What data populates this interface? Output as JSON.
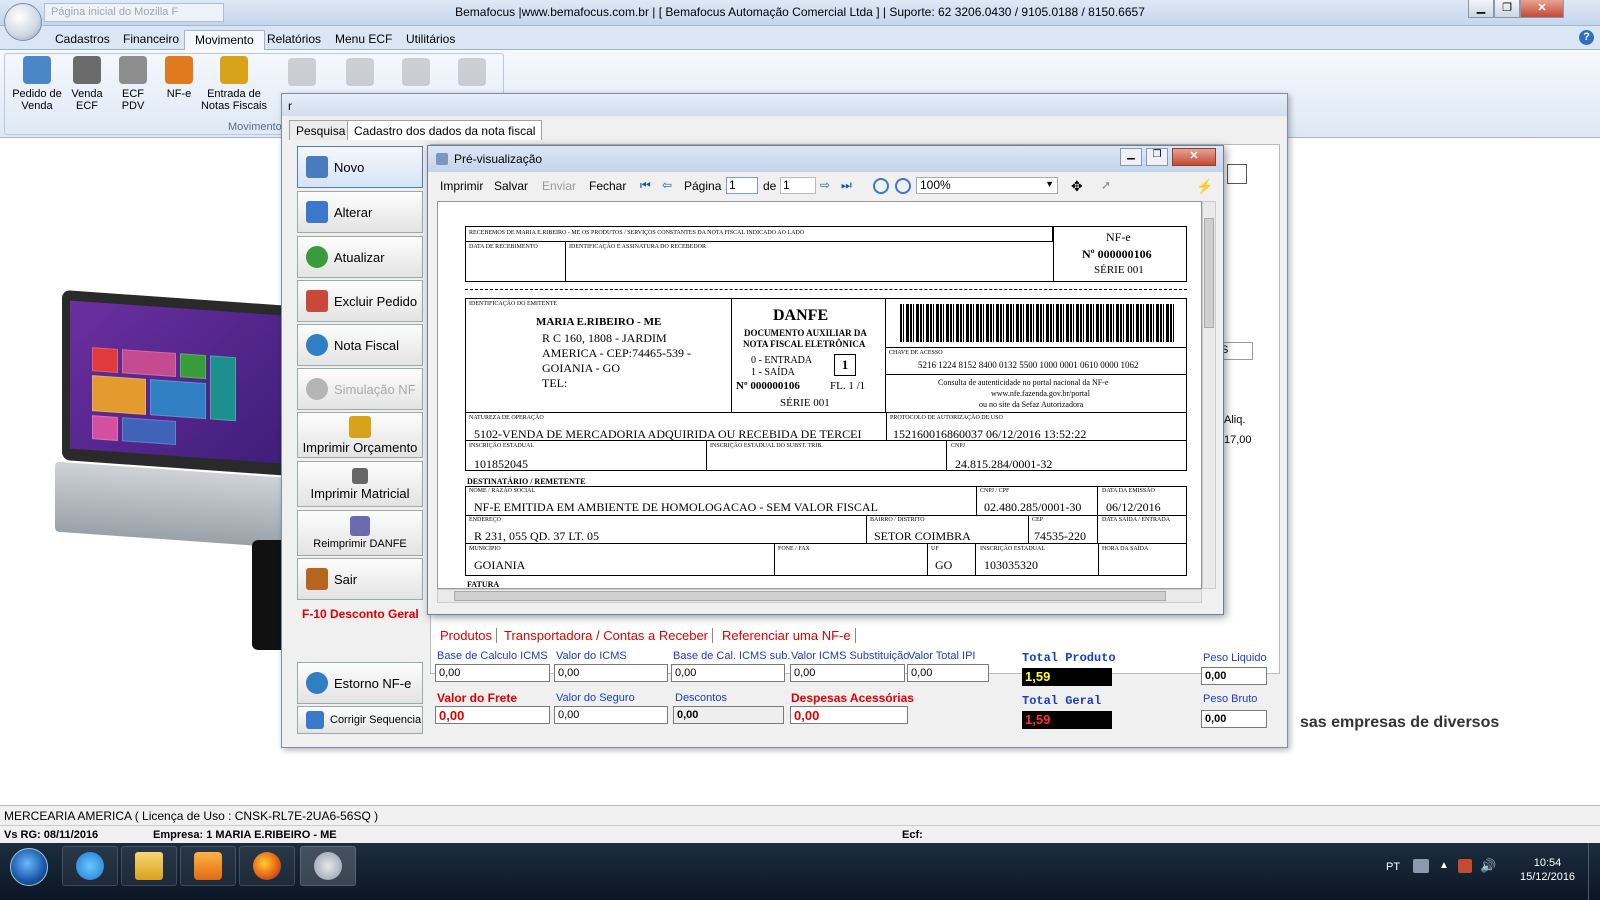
{
  "window": {
    "address_placeholder": "Página inicial do Mozilla F",
    "title": "Bemafocus |www.bemafocus.com.br | [ Bemafocus Automação Comercial Ltda ] | Suporte: 62 3206.0430 / 9105.0188 / 8150.6657",
    "min_label": "▁",
    "max_label": "❐",
    "close_label": "✕"
  },
  "menu": {
    "tabs": [
      "Cadastros",
      "Financeiro",
      "Movimento",
      "Relatórios",
      "Menu ECF",
      "Utilitários"
    ],
    "active": "Movimento",
    "help": "?"
  },
  "ribbon": {
    "buttons": [
      {
        "label": "Pedido de Venda",
        "icon": "basket-icon",
        "color": "#4a86c8"
      },
      {
        "label": "Venda ECF",
        "icon": "printer-icon",
        "color": "#6b6b6b"
      },
      {
        "label": "ECF PDV",
        "icon": "cart-icon",
        "color": "#8d8d8d"
      },
      {
        "label": "NF-e",
        "icon": "nfe-icon",
        "color": "#e07a1f"
      },
      {
        "label": "Entrada de Notas Fiscais",
        "icon": "forklift-icon",
        "color": "#d9a21b"
      }
    ],
    "group_label": "Movimento"
  },
  "main_dialog": {
    "title": "r",
    "tabs": [
      "Pesquisa",
      "Cadastro dos dados da nota fiscal"
    ],
    "active_tab": "Cadastro dos dados da nota fiscal",
    "buttons": [
      {
        "label": "Novo",
        "icon": "person-icon",
        "color": "#4b7bbf"
      },
      {
        "label": "Alterar",
        "icon": "edit-icon",
        "color": "#3a78c9"
      },
      {
        "label": "Atualizar",
        "icon": "refresh-icon",
        "color": "#3a9b3a"
      },
      {
        "label": "Excluir Pedido",
        "icon": "delete-icon",
        "color": "#c9483a"
      },
      {
        "label": "Nota Fiscal",
        "icon": "nfe-icon",
        "color": "#2f7fc2"
      },
      {
        "label": "Simulação  NF",
        "icon": "gear-icon",
        "color": "#b5b5b5"
      },
      {
        "label": "Imprimir Orçamento",
        "icon": "stack-icon",
        "color": "#d9a21b"
      },
      {
        "label": "Imprimir Matricial",
        "icon": "printer-icon",
        "color": "#666666"
      },
      {
        "label": "Reimprimir DANFE",
        "icon": "printer-icon",
        "color": "#6b6bb0"
      },
      {
        "label": "Sair",
        "icon": "door-icon",
        "color": "#b5651d"
      },
      {
        "label": "Estorno NF-e",
        "icon": "nfe-icon",
        "color": "#2f7fc2"
      },
      {
        "label": "Corrigir Sequencia",
        "icon": "person-icon",
        "color": "#3a78c9"
      }
    ],
    "f10_label": "F-10 Desconto Geral",
    "aliq_header": "Aliq.",
    "aliq_value": "17,00"
  },
  "preview": {
    "title": "Pré-visualização",
    "toolbar": {
      "print": "Imprimir",
      "save": "Salvar",
      "send": "Enviar",
      "close": "Fechar",
      "page_label": "Página",
      "page_value": "1",
      "of_label": "de",
      "page_total": "1",
      "zoom": "100%"
    }
  },
  "danfe": {
    "receipt_header": "RECEBEMOS DE MARIA E.RIBEIRO - ME OS PRODUTOS / SERVIÇOS CONSTANTES DA NOTA FISCAL INDICADO AO LADO",
    "receipt_date": "DATA DE RECEBIMENTO",
    "receipt_sign": "IDENTIFICAÇÃO E ASSINATURA DO RECEBEDOR",
    "nfe_label": "NF-e",
    "nfe_number": "Nº 000000106",
    "nfe_series": "SÉRIE 001",
    "issuer_label": "IDENTIFICAÇÃO DO EMITENTE",
    "issuer_name": "MARIA E.RIBEIRO - ME",
    "issuer_addr1": "R C 160, 1808  - JARDIM",
    "issuer_addr2": "AMERICA - CEP:74465-539 -",
    "issuer_addr3": "GOIANIA - GO",
    "issuer_tel": "TEL:",
    "danfe_title": "DANFE",
    "danfe_sub1": "DOCUMENTO AUXILIAR DA",
    "danfe_sub2": "NOTA FISCAL ELETRÔNICA",
    "entrada": "0 - ENTRADA",
    "saida": "1 - SAÍDA",
    "tipo": "1",
    "number_line": "Nº 000000106",
    "folha": "FL. 1 /1",
    "series_line": "SÉRIE 001",
    "chave_label": "CHAVE DE ACESSO",
    "chave": "5216 1224 8152 8400 0132 5500 1000 0001 0610 0000 1062",
    "consulta1": "Consulta de autenticidade no portal nacional da NF-e",
    "consulta2": "www.nfe.fazenda.gov.br/portal",
    "consulta3": "ou no site da Sefaz Autorizadora",
    "natureza_label": "NATUREZA DE OPERAÇÃO",
    "natureza": "5102-VENDA DE MERCADORIA ADQUIRIDA OU RECEBIDA DE TERCEI",
    "protocolo_label": "PROTOCOLO DE AUTORIZAÇÃO DE USO",
    "protocolo": "152160016860037 06/12/2016 13:52:22",
    "ie_label": "INSCRIÇÃO ESTADUAL",
    "ie": "101852045",
    "ie_st_label": "INSCRIÇÃO ESTADUAL DO SUBST. TRIB.",
    "cnpj_label": "CNPJ",
    "cnpj": "24.815.284/0001-32",
    "dest_header": "DESTINATÁRIO / REMETENTE",
    "nome_label": "NOME / RAZÃO SOCIAL",
    "nome": "NF-E EMITIDA EM AMBIENTE DE HOMOLOGACAO - SEM VALOR FISCAL",
    "cpf_label": "CNPJ / CPF",
    "cpf": "02.480.285/0001-30",
    "emissao_label": "DATA DA EMISSÃO",
    "emissao": "06/12/2016",
    "endereco_label": "ENDEREÇO",
    "endereco": "R 231, 055 QD. 37 LT. 05",
    "bairro_label": "BAIRRO / DISTRITO",
    "bairro": "SETOR COIMBRA",
    "cep_label": "CEP",
    "cep": "74535-220",
    "saida_label": "DATA SAÍDA / ENTRADA",
    "municipio_label": "MUNICÍPIO",
    "municipio": "GOIANIA",
    "fone_label": "FONE / FAX",
    "uf_label": "UF",
    "uf": "GO",
    "ie_dest_label": "INSCRIÇÃO ESTADUAL",
    "ie_dest": "103035320",
    "hora_label": "HORA DA SAÍDA",
    "fatura_label": "FATURA"
  },
  "bottom": {
    "tabs": [
      "Produtos",
      "Transportadora / Contas a Receber",
      "Referenciar uma NF-e"
    ],
    "fields": {
      "base_icms_label": "Base de Calculo ICMS",
      "base_icms": "0,00",
      "valor_icms_label": "Valor do ICMS",
      "valor_icms": "0,00",
      "base_sub_label": "Base de Cal. ICMS sub.",
      "base_sub": "0,00",
      "icms_sub_label": "Valor ICMS Substituição",
      "icms_sub": "0,00",
      "ipi_label": "Valor Total IPI",
      "ipi": "0,00",
      "frete_label": "Valor do Frete",
      "frete": "0,00",
      "seguro_label": "Valor do Seguro",
      "seguro": "0,00",
      "descontos_label": "Descontos",
      "descontos": "0,00",
      "despesas_label": "Despesas Acessórias",
      "despesas": "0,00",
      "total_produto_label": "Total Produto",
      "total_produto": "1,59",
      "total_geral_label": "Total Geral",
      "total_geral": "1,59",
      "peso_liquido_label": "Peso Liquido",
      "peso_liquido": "0,00",
      "peso_bruto_label": "Peso Bruto",
      "peso_bruto": "0,00"
    }
  },
  "background": {
    "promo": "sas empresas de diversos"
  },
  "status": {
    "line1": "MERCEARIA AMERICA  ( Licença de Uso : CNSK-RL7E-2UA6-56SQ )",
    "version": "Vs RG: 08/11/2016",
    "empresa": "Empresa: 1 MARIA E.RIBEIRO - ME",
    "ecf": "Ecf:"
  },
  "taskbar": {
    "apps": [
      "internet-explorer-icon",
      "file-explorer-icon",
      "media-player-icon",
      "firefox-icon",
      "bemafocus-icon"
    ],
    "lang": "PT",
    "time": "10:54",
    "date": "15/12/2016"
  },
  "colors": {
    "accent_red": "#dd0000",
    "accent_blue": "#1a3cc7",
    "total_yellow": "#ffff33",
    "total_red": "#ff3030"
  }
}
